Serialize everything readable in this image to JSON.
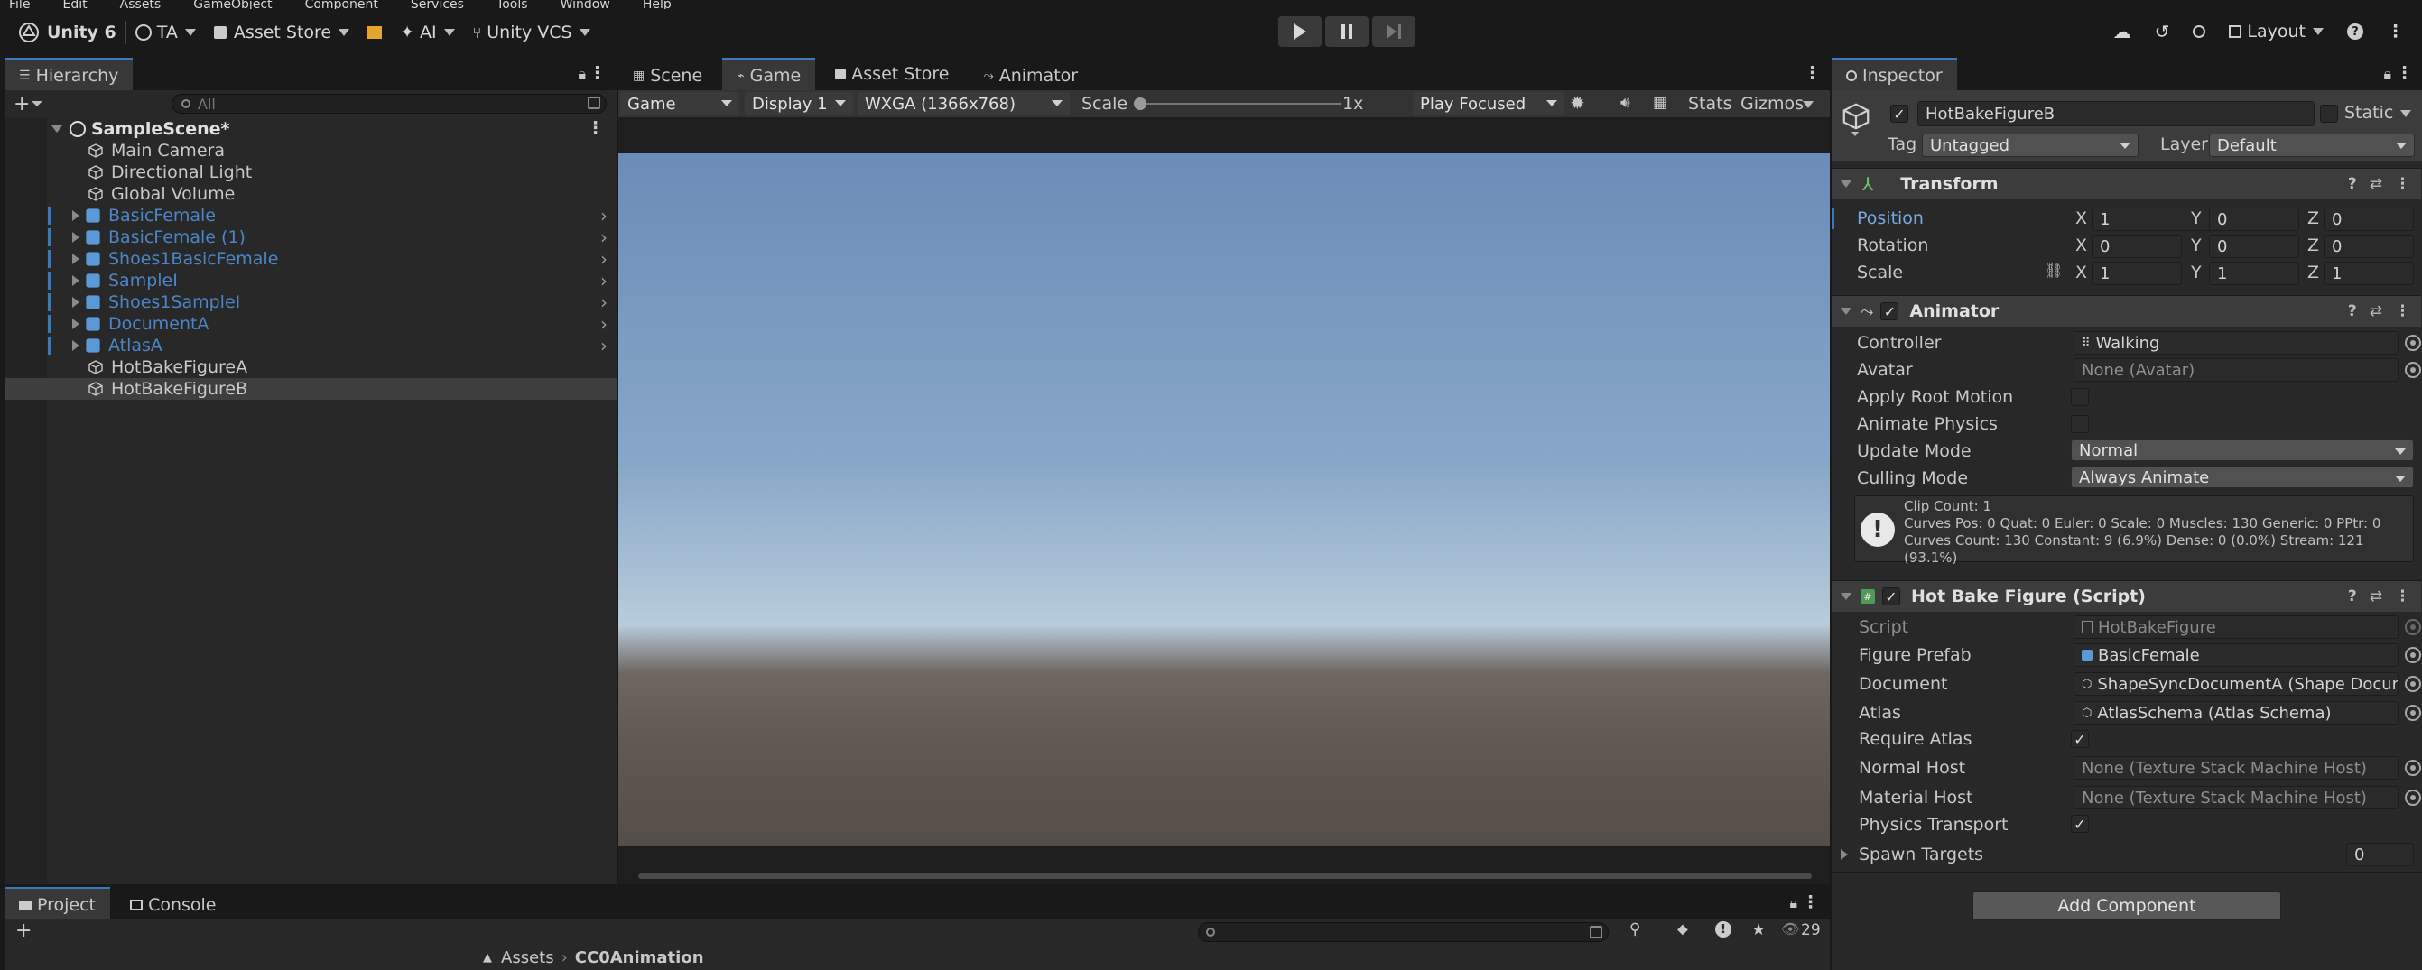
{
  "menu": [
    "File",
    "Edit",
    "Assets",
    "GameObject",
    "Component",
    "Services",
    "Tools",
    "Window",
    "Help"
  ],
  "toolbar": {
    "unity_version": "Unity 6",
    "account": "TA",
    "asset_store": "Asset Store",
    "ai": "AI",
    "vcs": "Unity VCS",
    "layout": "Layout"
  },
  "hierarchy": {
    "tab": "Hierarchy",
    "search_placeholder": "All",
    "scene": "SampleScene*",
    "items": [
      {
        "label": "Main Camera",
        "prefab": false
      },
      {
        "label": "Directional Light",
        "prefab": false
      },
      {
        "label": "Global Volume",
        "prefab": false
      },
      {
        "label": "BasicFemale",
        "prefab": true
      },
      {
        "label": "BasicFemale (1)",
        "prefab": true
      },
      {
        "label": "Shoes1BasicFemale",
        "prefab": true
      },
      {
        "label": "SampleI",
        "prefab": true
      },
      {
        "label": "Shoes1SampleI",
        "prefab": true
      },
      {
        "label": "DocumentA",
        "prefab": true
      },
      {
        "label": "AtlasA",
        "prefab": true
      },
      {
        "label": "HotBakeFigureA",
        "prefab": false
      },
      {
        "label": "HotBakeFigureB",
        "prefab": false,
        "selected": true
      }
    ]
  },
  "center_tabs": [
    "Scene",
    "Game",
    "Asset Store",
    "Animator"
  ],
  "game_bar": {
    "mode": "Game",
    "display": "Display 1",
    "resolution": "WXGA (1366x768)",
    "scale_label": "Scale",
    "scale_value": "1x",
    "play_mode": "Play Focused",
    "stats": "Stats",
    "gizmos": "Gizmos"
  },
  "project": {
    "tabs": [
      "Project",
      "Console"
    ],
    "visible_count": "29",
    "breadcrumb": [
      "Assets",
      "CC0Animation"
    ]
  },
  "inspector": {
    "tab": "Inspector",
    "object_name": "HotBakeFigureB",
    "static_label": "Static",
    "tag_label": "Tag",
    "tag_value": "Untagged",
    "layer_label": "Layer",
    "layer_value": "Default",
    "transform": {
      "title": "Transform",
      "position_label": "Position",
      "rotation_label": "Rotation",
      "scale_label": "Scale",
      "position": [
        "1",
        "0",
        "0"
      ],
      "rotation": [
        "0",
        "0",
        "0"
      ],
      "scale": [
        "1",
        "1",
        "1"
      ]
    },
    "animator": {
      "title": "Animator",
      "controller_label": "Controller",
      "controller_value": "Walking",
      "avatar_label": "Avatar",
      "avatar_value": "None (Avatar)",
      "root_motion_label": "Apply Root Motion",
      "physics_label": "Animate Physics",
      "update_mode_label": "Update Mode",
      "update_mode_value": "Normal",
      "culling_label": "Culling Mode",
      "culling_value": "Always Animate",
      "info_line1": "Clip Count: 1",
      "info_line2": "Curves Pos: 0 Quat: 0 Euler: 0 Scale: 0 Muscles: 130 Generic: 0 PPtr: 0",
      "info_line3": "Curves Count: 130 Constant: 9 (6.9%) Dense: 0 (0.0%) Stream: 121 (93.1%)"
    },
    "script": {
      "title": "Hot Bake Figure (Script)",
      "script_label": "Script",
      "script_value": "HotBakeFigure",
      "figure_prefab_label": "Figure Prefab",
      "figure_prefab_value": "BasicFemale",
      "document_label": "Document",
      "document_value": "ShapeSyncDocumentA (Shape Docum",
      "atlas_label": "Atlas",
      "atlas_value": "AtlasSchema (Atlas Schema)",
      "require_atlas_label": "Require Atlas",
      "normal_host_label": "Normal Host",
      "normal_host_value": "None (Texture Stack Machine Host)",
      "material_host_label": "Material Host",
      "material_host_value": "None (Texture Stack Machine Host)",
      "physics_transport_label": "Physics Transport",
      "spawn_targets_label": "Spawn Targets",
      "spawn_targets_value": "0"
    },
    "add_component": "Add Component"
  },
  "colors": {
    "accent": "#3a79bb",
    "prefab": "#4c85c7",
    "position_highlight": "#7aa8e0",
    "sky_top": "#6f90b8",
    "ground": "#5b5450"
  }
}
